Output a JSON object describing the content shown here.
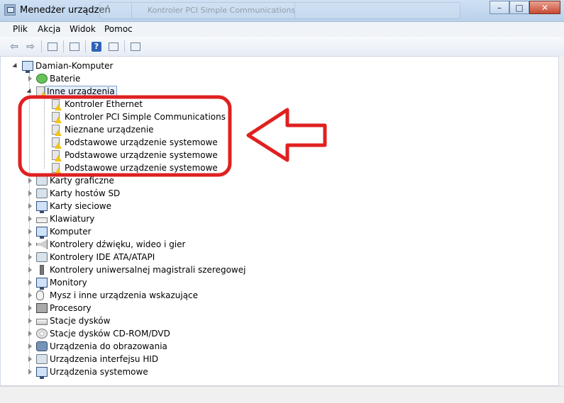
{
  "window": {
    "title": "Menedżer urządzeń",
    "ghost_tabs": [
      "",
      "Kontroler PCI Simple Communications",
      ""
    ],
    "buttons": {
      "minimize": "–",
      "maximize": "□",
      "close": "✕"
    }
  },
  "menu": {
    "items": [
      "Plik",
      "Akcja",
      "Widok",
      "Pomoc"
    ]
  },
  "toolbar": {
    "icons": [
      "back-arrow-icon",
      "forward-arrow-icon",
      "show-hide-console-tree-icon",
      "properties-icon",
      "help-icon",
      "scan-hardware-icon"
    ]
  },
  "tree": {
    "root": {
      "label": "Damian-Komputer"
    },
    "categories": [
      {
        "label": "Baterie",
        "icon": "battery-icon",
        "expanded": false
      },
      {
        "label": "Inne urządzenia",
        "icon": "other-devices-icon",
        "expanded": true,
        "children": [
          {
            "label": "Kontroler Ethernet"
          },
          {
            "label": "Kontroler PCI Simple Communications"
          },
          {
            "label": "Nieznane urządzenie"
          },
          {
            "label": "Podstawowe urządzenie systemowe"
          },
          {
            "label": "Podstawowe urządzenie systemowe"
          },
          {
            "label": "Podstawowe urządzenie systemowe"
          }
        ]
      },
      {
        "label": "Karty graficzne",
        "icon": "display-adapter-icon",
        "expanded": false
      },
      {
        "label": "Karty hostów SD",
        "icon": "sd-host-icon",
        "expanded": false
      },
      {
        "label": "Karty sieciowe",
        "icon": "network-adapter-icon",
        "expanded": false
      },
      {
        "label": "Klawiatury",
        "icon": "keyboard-icon",
        "expanded": false
      },
      {
        "label": "Komputer",
        "icon": "computer-icon",
        "expanded": false
      },
      {
        "label": "Kontrolery dźwięku, wideo i gier",
        "icon": "sound-icon",
        "expanded": false
      },
      {
        "label": "Kontrolery IDE ATA/ATAPI",
        "icon": "ide-controller-icon",
        "expanded": false
      },
      {
        "label": "Kontrolery uniwersalnej magistrali szeregowej",
        "icon": "usb-icon",
        "expanded": false
      },
      {
        "label": "Monitory",
        "icon": "monitor-icon",
        "expanded": false
      },
      {
        "label": "Mysz i inne urządzenia wskazujące",
        "icon": "mouse-icon",
        "expanded": false
      },
      {
        "label": "Procesory",
        "icon": "processor-icon",
        "expanded": false
      },
      {
        "label": "Stacje dysków",
        "icon": "disk-drive-icon",
        "expanded": false
      },
      {
        "label": "Stacje dysków CD-ROM/DVD",
        "icon": "cdrom-icon",
        "expanded": false
      },
      {
        "label": "Urządzenia do obrazowania",
        "icon": "imaging-device-icon",
        "expanded": false
      },
      {
        "label": "Urządzenia interfejsu HID",
        "icon": "hid-icon",
        "expanded": false
      },
      {
        "label": "Urządzenia systemowe",
        "icon": "system-devices-icon",
        "expanded": false
      }
    ]
  },
  "annotation": {
    "color": "#e02020"
  }
}
